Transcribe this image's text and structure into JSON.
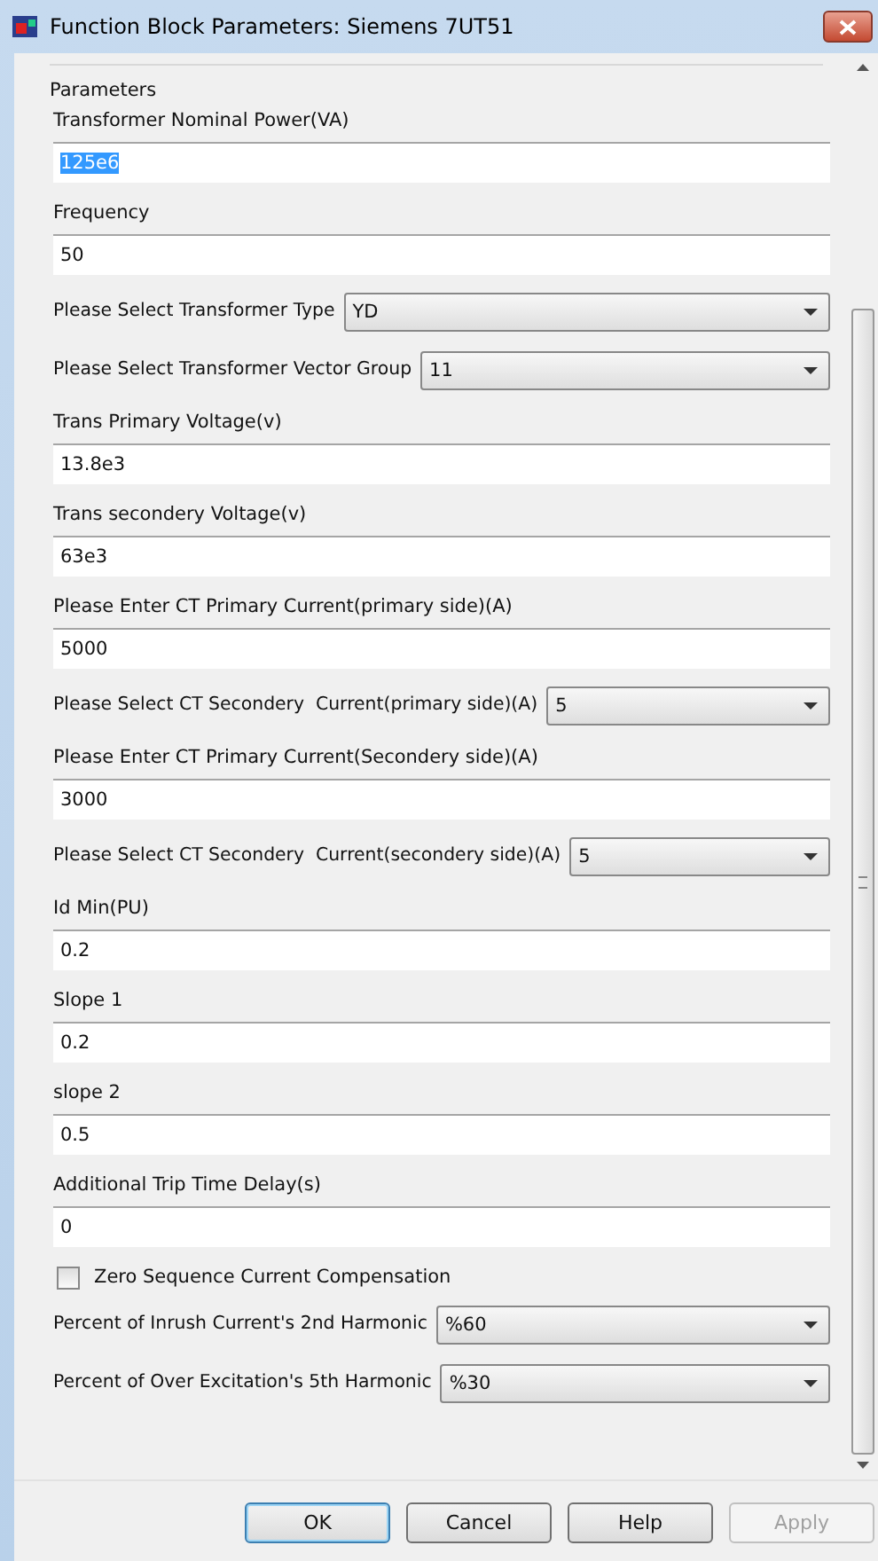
{
  "window": {
    "title": "Function Block Parameters: Siemens 7UT51"
  },
  "group": {
    "title": "Parameters"
  },
  "params": [
    {
      "kind": "text",
      "label": "Transformer Nominal Power(VA)",
      "value": "125e6",
      "text_selected": true
    },
    {
      "kind": "text",
      "label": "Frequency",
      "value": "50",
      "text_selected": false
    },
    {
      "kind": "select",
      "label": "Please Select Transformer Type",
      "value": "YD"
    },
    {
      "kind": "select",
      "label": "Please Select Transformer Vector Group",
      "value": "11"
    },
    {
      "kind": "text",
      "label": "Trans Primary Voltage(v)",
      "value": "13.8e3",
      "text_selected": false
    },
    {
      "kind": "text",
      "label": "Trans secondery Voltage(v)",
      "value": "63e3",
      "text_selected": false
    },
    {
      "kind": "text",
      "label": "Please Enter CT Primary Current(primary side)(A)",
      "value": "5000",
      "text_selected": false
    },
    {
      "kind": "select",
      "label": "Please Select CT Secondery  Current(primary side)(A)",
      "value": "5"
    },
    {
      "kind": "text",
      "label": "Please Enter CT Primary Current(Secondery side)(A)",
      "value": "3000",
      "text_selected": false
    },
    {
      "kind": "select",
      "label": "Please Select CT Secondery  Current(secondery side)(A)",
      "value": "5"
    },
    {
      "kind": "text",
      "label": "Id Min(PU)",
      "value": "0.2",
      "text_selected": false
    },
    {
      "kind": "text",
      "label": "Slope 1",
      "value": "0.2",
      "text_selected": false
    },
    {
      "kind": "text",
      "label": "slope 2",
      "value": "0.5",
      "text_selected": false
    },
    {
      "kind": "text",
      "label": "Additional Trip Time Delay(s)",
      "value": "0",
      "text_selected": false
    },
    {
      "kind": "checkbox",
      "label": "Zero Sequence Current Compensation",
      "checked": false
    },
    {
      "kind": "select",
      "label": "Percent of Inrush Current's 2nd Harmonic",
      "value": "%60"
    },
    {
      "kind": "select",
      "label": "Percent of Over Excitation's 5th Harmonic",
      "value": "%30"
    }
  ],
  "buttons": [
    {
      "label": "OK",
      "disabled": false,
      "default": true
    },
    {
      "label": "Cancel",
      "disabled": false,
      "default": false
    },
    {
      "label": "Help",
      "disabled": false,
      "default": false
    },
    {
      "label": "Apply",
      "disabled": true,
      "default": false
    }
  ]
}
